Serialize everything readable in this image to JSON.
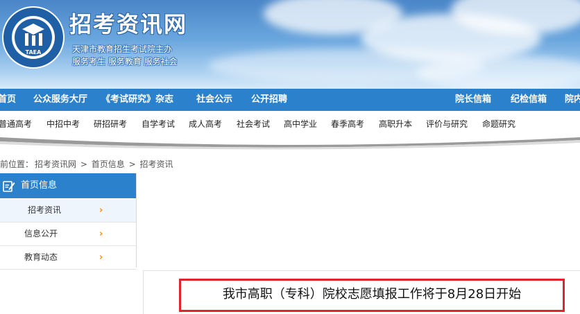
{
  "header": {
    "logo_text": "TAEA",
    "title": "招考资讯网",
    "subtitle1": "天津市教育招生考试院主办",
    "subtitle2": "服务考生 服务教育 服务社会"
  },
  "nav_primary": {
    "items": [
      {
        "label": "首页"
      },
      {
        "label": "公众服务大厅"
      },
      {
        "label": "《考试研究》杂志"
      },
      {
        "label": "社会公示"
      },
      {
        "label": "公开招聘"
      },
      {
        "label": "院长信箱"
      },
      {
        "label": "纪检信箱"
      },
      {
        "label": "院内"
      }
    ]
  },
  "nav_secondary": {
    "items": [
      {
        "label": "普通高考"
      },
      {
        "label": "中招中考"
      },
      {
        "label": "研招研考"
      },
      {
        "label": "自学考试"
      },
      {
        "label": "成人高考"
      },
      {
        "label": "社会考试"
      },
      {
        "label": "高中学业"
      },
      {
        "label": "春季高考"
      },
      {
        "label": "高职升本"
      },
      {
        "label": "评价与研究"
      },
      {
        "label": "命题研究"
      }
    ]
  },
  "breadcrumb": {
    "prefix": "前位置：",
    "items": [
      "招考资讯网",
      "首页信息",
      "招考资讯"
    ],
    "separator": ">"
  },
  "sidebar": {
    "title": "首页信息",
    "items": [
      {
        "label": "招考资讯",
        "active": true
      },
      {
        "label": "信息公开",
        "active": false
      },
      {
        "label": "教育动态",
        "active": false
      }
    ],
    "chevron": "›"
  },
  "article": {
    "title": "我市高职（专科）院校志愿填报工作将于8月28日开始"
  },
  "colors": {
    "nav_blue": "#2c81cc",
    "chevron_orange": "#ff8a00",
    "highlight_red": "#e0242f"
  },
  "icons": {
    "sidebar_head": "edit-note-icon",
    "chevron": "chevron-right-icon"
  }
}
